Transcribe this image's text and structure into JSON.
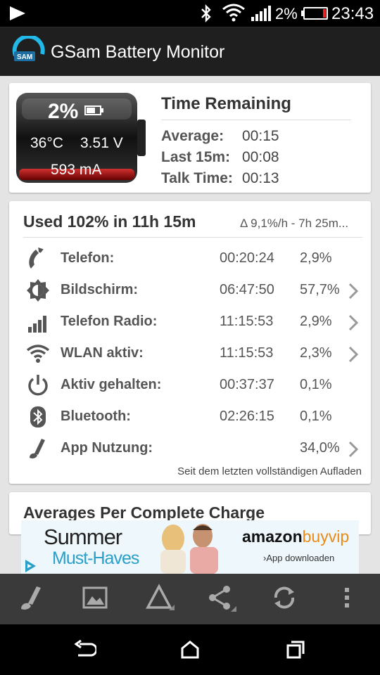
{
  "status_bar": {
    "battery_percent": "2%",
    "time": "23:43"
  },
  "app": {
    "title": "GSam Battery Monitor"
  },
  "battery": {
    "percent": "2%",
    "temperature": "36°C",
    "voltage": "3.51 V",
    "current": "593 mA",
    "level": 0.02
  },
  "time_remaining": {
    "title": "Time Remaining",
    "rows": [
      {
        "label": "Average:",
        "value": "00:15"
      },
      {
        "label": "Last 15m:",
        "value": "00:08"
      },
      {
        "label": "Talk Time:",
        "value": "00:13"
      }
    ]
  },
  "usage": {
    "title": "Used 102% in 11h 15m",
    "rate": "Δ 9,1%/h - 7h 25m...",
    "rows": [
      {
        "icon": "phone-icon",
        "label": "Telefon:",
        "time": "00:20:24",
        "percent": "2,9%",
        "chevron": false
      },
      {
        "icon": "brightness-icon",
        "label": "Bildschirm:",
        "time": "06:47:50",
        "percent": "57,7%",
        "chevron": true
      },
      {
        "icon": "signal-icon",
        "label": "Telefon Radio:",
        "time": "11:15:53",
        "percent": "2,9%",
        "chevron": true
      },
      {
        "icon": "wifi-icon",
        "label": "WLAN aktiv:",
        "time": "11:15:53",
        "percent": "2,3%",
        "chevron": true
      },
      {
        "icon": "power-icon",
        "label": "Aktiv gehalten:",
        "time": "00:37:37",
        "percent": "0,1%",
        "chevron": false
      },
      {
        "icon": "bluetooth-icon",
        "label": "Bluetooth:",
        "time": "02:26:15",
        "percent": "0,1%",
        "chevron": false
      },
      {
        "icon": "app-usage-icon",
        "label": "App Nutzung:",
        "time": "",
        "percent": "34,0%",
        "chevron": true
      }
    ],
    "footer": "Seit dem letzten vollständigen Aufladen"
  },
  "averages": {
    "title": "Averages Per Complete Charge"
  },
  "ad": {
    "line1": "Summer",
    "line2": "Must-Haves",
    "brand_a": "amazon",
    "brand_b": "buyvip",
    "cta": "›App downloaden"
  },
  "colors": {
    "appbar": "#1f1f1f",
    "toolbar": "#3a3a3a",
    "accent_blue": "#2aa0c8",
    "battery_red": "#b01818"
  }
}
